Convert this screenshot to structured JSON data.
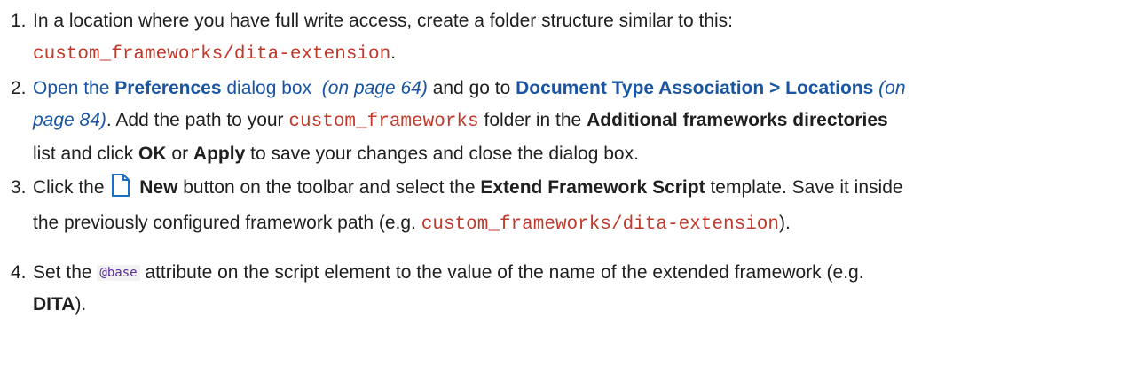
{
  "steps": [
    {
      "num": "1.",
      "text1": "In a location where you have full write access, create a folder structure similar to this:",
      "code": "custom_frameworks/dita-extension",
      "tail": "."
    },
    {
      "num": "2.",
      "link_open": "Open the",
      "link_bold": "Preferences",
      "link_tail": "dialog box",
      "page_ref_1": "(on page 64)",
      "mid1": "and go to",
      "bold_path": "Document Type Association > Locations",
      "page_ref_2a": "(on",
      "page_ref_2b": "page 84)",
      "mid2": ". Add the path to your",
      "code": "custom_frameworks",
      "mid3": "folder in the",
      "bold_dirs": "Additional frameworks directories",
      "mid4": "list and click",
      "bold_ok": "OK",
      "mid5": "or",
      "bold_apply": "Apply",
      "end": "to save your changes and close the dialog box."
    },
    {
      "num": "3.",
      "pre": "Click the",
      "icon": "new-document-icon",
      "bold_new": "New",
      "mid1": "button on the toolbar and select the",
      "bold_template": "Extend Framework Script",
      "mid2": "template. Save it inside",
      "line2_pre": "the previously configured framework path (e.g.",
      "code": "custom_frameworks/dita-extension",
      "line2_end": ")."
    },
    {
      "num": "4.",
      "pre": "Set the",
      "attr": "@base",
      "mid": "attribute on the script element to the value of the name of the extended framework (e.g.",
      "bold_dita": "DITA",
      "end": ")."
    }
  ],
  "colors": {
    "code": "#c0392b",
    "link": "#1a55a3",
    "attr": "#5b2d9c",
    "icon": "#1a6fc4"
  }
}
